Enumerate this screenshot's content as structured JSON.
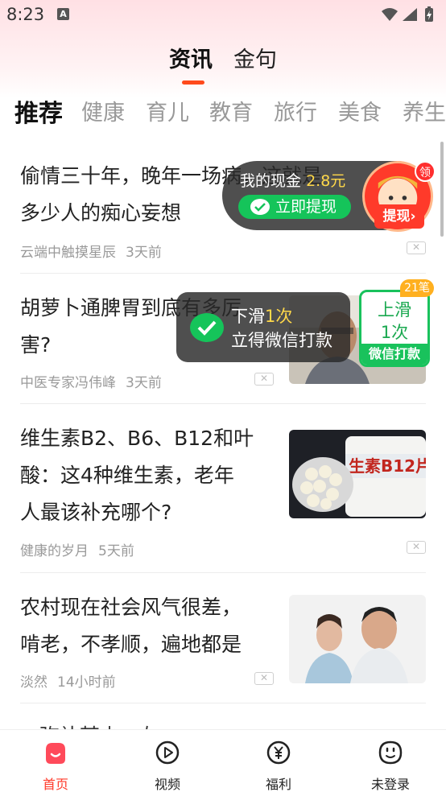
{
  "status_bar": {
    "time": "8:23",
    "notification_glyph": "A",
    "icons": [
      "wifi-icon",
      "signal-icon",
      "battery-charging-icon"
    ]
  },
  "main_tabs": [
    {
      "label": "资讯",
      "active": true
    },
    {
      "label": "金句",
      "active": false
    }
  ],
  "category_tabs": [
    {
      "label": "推荐",
      "active": true
    },
    {
      "label": "健康"
    },
    {
      "label": "育儿"
    },
    {
      "label": "教育"
    },
    {
      "label": "旅行"
    },
    {
      "label": "美食"
    },
    {
      "label": "养生"
    }
  ],
  "feed": [
    {
      "title_lines": [
        "偷情三十年，晚年一场病，这就是",
        "多少人的痴心妄想"
      ],
      "source": "云端中触摸星辰",
      "time": "3天前",
      "thumbnail": null
    },
    {
      "title_lines": [
        "胡萝卜通脾胃到底有多厉",
        "害?"
      ],
      "source": "中医专家冯伟峰",
      "time": "3天前",
      "thumbnail": "man-portrait"
    },
    {
      "title_lines": [
        "维生素B2、B6、B12和叶",
        "酸：这4种维生素，老年",
        "人最该补充哪个?"
      ],
      "source": "健康的岁月",
      "time": "5天前",
      "thumbnail": "vitamin-b12-bottle",
      "thumbnail_text": "生素B12片"
    },
    {
      "title_lines": [
        "农村现在社会风气很差，",
        "啃老，不孝顺，遍地都是"
      ],
      "source": "淡然",
      "time": "14小时前",
      "thumbnail": "sad-couple"
    },
    {
      "title_lines": [
        "...弥补某少...左...."
      ],
      "partial": true
    }
  ],
  "cash_overlay": {
    "label": "我的现金",
    "amount": "2.8元",
    "withdraw_button": "立即提现",
    "avatar_badge": "领",
    "avatar_button": "提现",
    "colors": {
      "green": "#15c45a",
      "amount": "#ffd84a",
      "red": "#ff3a2a"
    }
  },
  "swipe_toast": {
    "line1_prefix": "下滑",
    "line1_highlight": "1次",
    "line2": "立得微信打款"
  },
  "swipe_card": {
    "count_badge": "21笔",
    "line1": "上滑",
    "line2": "1次",
    "footer": "微信打款"
  },
  "bottom_nav": [
    {
      "label": "首页",
      "icon": "home-icon",
      "active": true
    },
    {
      "label": "视频",
      "icon": "video-play-icon"
    },
    {
      "label": "福利",
      "icon": "yuan-coin-icon"
    },
    {
      "label": "未登录",
      "icon": "profile-face-icon"
    }
  ],
  "accent_color": "#ff4a1c"
}
